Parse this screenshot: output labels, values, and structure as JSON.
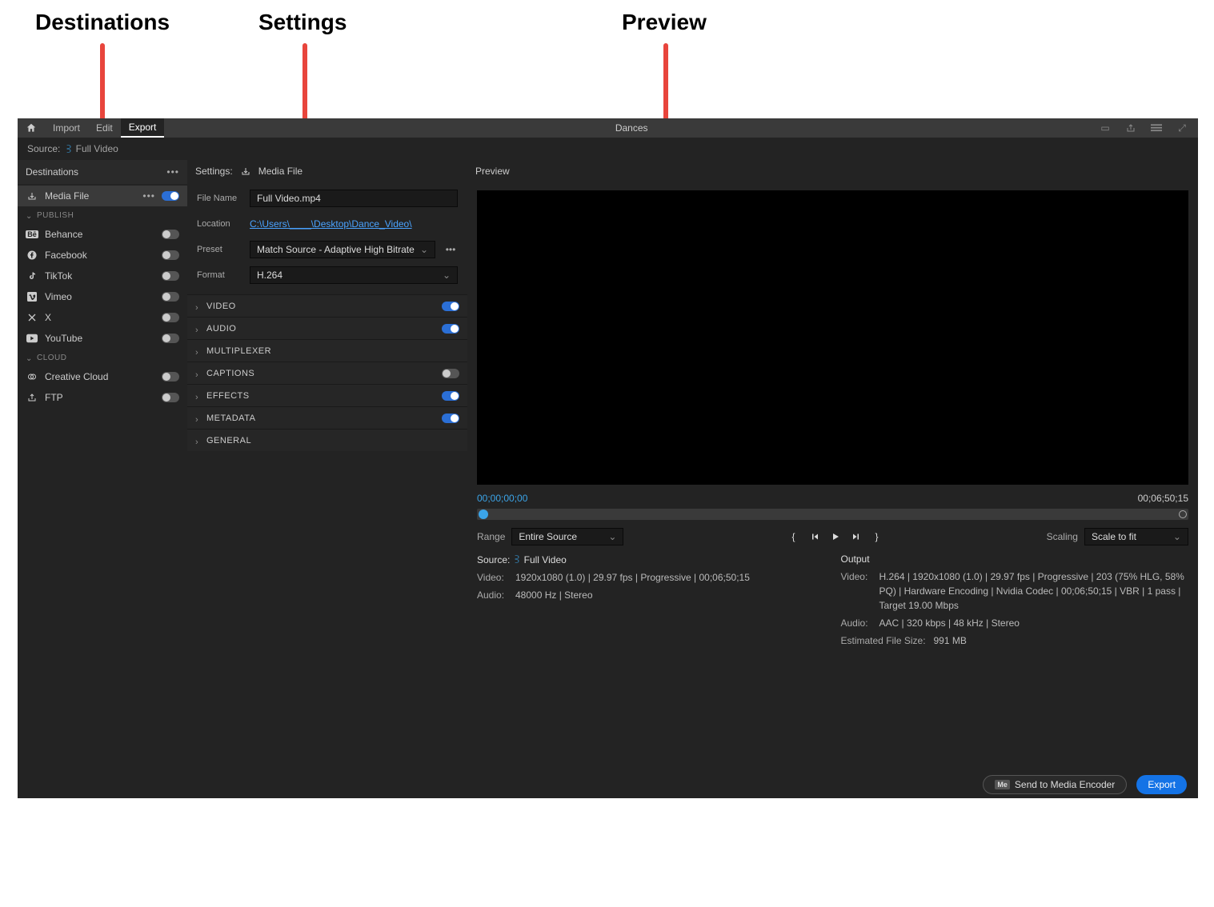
{
  "annotations": {
    "destinations": "Destinations",
    "settings": "Settings",
    "preview": "Preview"
  },
  "topbar": {
    "nav": {
      "import": "Import",
      "edit": "Edit",
      "export": "Export"
    },
    "title": "Dances"
  },
  "sourceBar": {
    "label": "Source:",
    "clipName": "Full Video"
  },
  "destinations": {
    "header": "Destinations",
    "mediaFile": "Media File",
    "sections": {
      "publish": "PUBLISH",
      "cloud": "CLOUD"
    },
    "items": {
      "behance": "Behance",
      "facebook": "Facebook",
      "tiktok": "TikTok",
      "vimeo": "Vimeo",
      "x": "X",
      "youtube": "YouTube",
      "creativeCloud": "Creative Cloud",
      "ftp": "FTP"
    }
  },
  "settings": {
    "header": "Settings:",
    "mediaFileLabel": "Media File",
    "labels": {
      "fileName": "File Name",
      "location": "Location",
      "preset": "Preset",
      "format": "Format"
    },
    "fileName": "Full Video.mp4",
    "location": "C:\\Users\\____\\Desktop\\Dance_Video\\",
    "preset": "Match Source - Adaptive High Bitrate",
    "format": "H.264",
    "groups": {
      "video": "VIDEO",
      "audio": "AUDIO",
      "multiplexer": "MULTIPLEXER",
      "captions": "CAPTIONS",
      "effects": "EFFECTS",
      "metadata": "METADATA",
      "general": "GENERAL"
    }
  },
  "preview": {
    "header": "Preview",
    "timeIn": "00;00;00;00",
    "timeOut": "00;06;50;15",
    "rangeLabel": "Range",
    "rangeValue": "Entire Source",
    "scalingLabel": "Scaling",
    "scalingValue": "Scale to fit"
  },
  "summary": {
    "sourceTitle": "Source:",
    "sourceClip": "Full Video",
    "outputTitle": "Output",
    "videoKey": "Video:",
    "audioKey": "Audio:",
    "estKey": "Estimated File Size:",
    "source": {
      "video": "1920x1080 (1.0) | 29.97 fps | Progressive | 00;06;50;15",
      "audio": "48000 Hz | Stereo"
    },
    "output": {
      "video": "H.264 | 1920x1080 (1.0) | 29.97 fps | Progressive | 203 (75% HLG, 58% PQ) | Hardware Encoding | Nvidia Codec | 00;06;50;15 | VBR | 1 pass | Target 19.00 Mbps",
      "audio": "AAC | 320 kbps | 48 kHz | Stereo",
      "estimated": "991 MB"
    }
  },
  "footer": {
    "sendToME": "Send to Media Encoder",
    "export": "Export"
  }
}
